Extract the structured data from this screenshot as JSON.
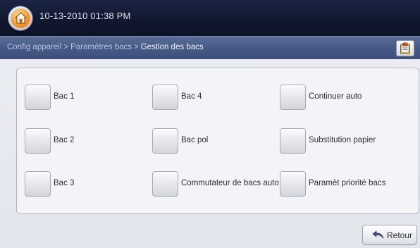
{
  "status_bar": {
    "datetime": "10-13-2010 01:38 PM",
    "home_icon": "home-icon"
  },
  "breadcrumb": {
    "items": [
      "Config appareil",
      "Paramètres bacs",
      "Gestion des bacs"
    ],
    "separator": ">",
    "action_icon": "clipboard-icon"
  },
  "options": [
    {
      "label": "Bac 1",
      "checked": false
    },
    {
      "label": "Bac 2",
      "checked": false
    },
    {
      "label": "Bac 3",
      "checked": false
    },
    {
      "label": "Bac 4",
      "checked": false
    },
    {
      "label": "Bac pol",
      "checked": false
    },
    {
      "label": "Commutateur de bacs auto",
      "checked": false
    },
    {
      "label": "Continuer auto",
      "checked": false
    },
    {
      "label": "Substitution papier",
      "checked": false
    },
    {
      "label": "Paramèt priorité bacs",
      "checked": false
    }
  ],
  "footer": {
    "back_label": "Retour",
    "back_icon": "undo-arrow-icon"
  },
  "colors": {
    "topbar": "#10172f",
    "crumbbar": "#475a86",
    "home_orange": "#f29a2e",
    "panel_bg": "#f3f4f7"
  }
}
